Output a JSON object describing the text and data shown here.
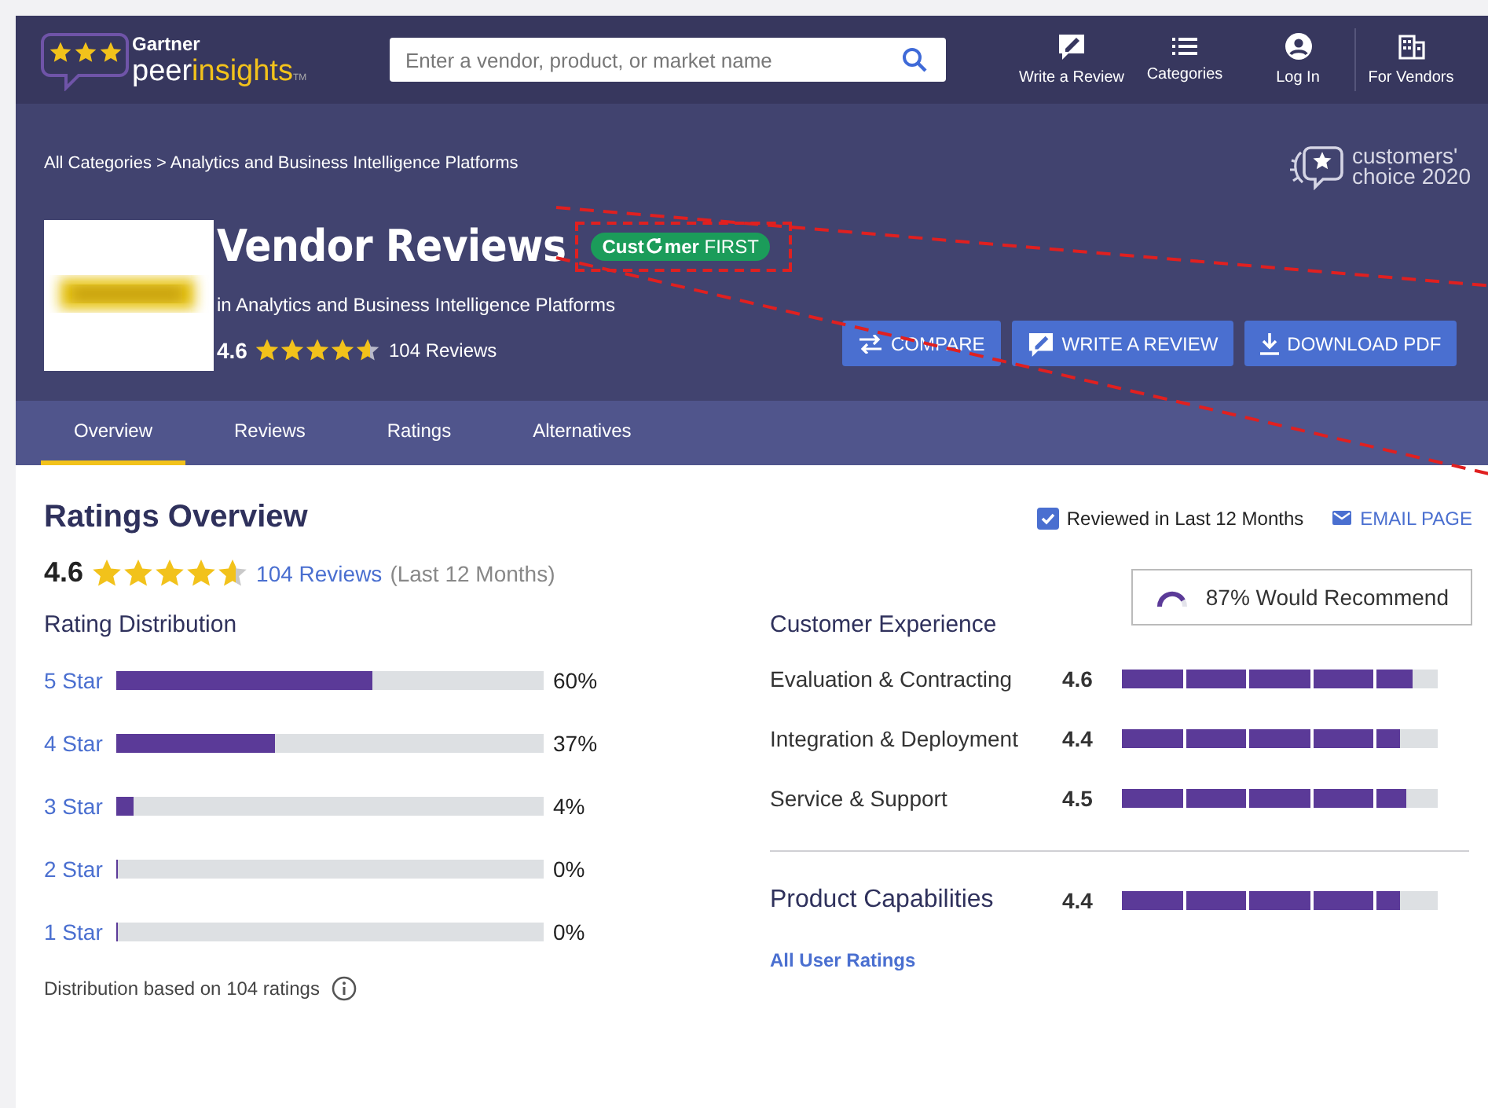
{
  "header": {
    "brand_top": "Gartner",
    "brand_main": "peer",
    "brand_accent": "insights",
    "brand_tm": "TM",
    "search": {
      "placeholder": "Enter a vendor, product, or market name"
    },
    "nav": [
      {
        "label": "Write a Review",
        "kind": "review"
      },
      {
        "label": "Categories",
        "kind": "list"
      },
      {
        "label": "Log In",
        "kind": "user"
      },
      {
        "label": "For Vendors",
        "kind": "building"
      }
    ]
  },
  "hero": {
    "breadcrumb": "All Categories > Analytics and Business Intelligence Platforms",
    "award": {
      "line1": "customers'",
      "line2": "choice 2020"
    },
    "title": "Vendor Reviews",
    "badge": {
      "strong": "Cust",
      "mid": "mer",
      "light": "FIRST"
    },
    "subtitle": "in Analytics and Business Intelligence Platforms",
    "rating": "4.6",
    "stars": 4.6,
    "reviews": "104 Reviews",
    "buttons": [
      {
        "label": "COMPARE",
        "kind": "compare"
      },
      {
        "label": "WRITE A REVIEW",
        "kind": "review"
      },
      {
        "label": "DOWNLOAD PDF",
        "kind": "download"
      }
    ]
  },
  "tabs": [
    {
      "label": "Overview",
      "selected": true
    },
    {
      "label": "Reviews",
      "selected": false
    },
    {
      "label": "Ratings",
      "selected": false
    },
    {
      "label": "Alternatives",
      "selected": false
    }
  ],
  "overview": {
    "title": "Ratings Overview",
    "filter": {
      "label": "Reviewed in Last 12 Months",
      "checked": true
    },
    "email": "EMAIL PAGE",
    "rating": "4.6",
    "stars": 4.6,
    "reviews_link": "104 Reviews",
    "period": "(Last 12 Months)",
    "recommend": "87% Would Recommend",
    "distribution": {
      "title": "Rating Distribution",
      "rows": [
        {
          "label": "5 Star",
          "level": 0.6,
          "percent": "60%"
        },
        {
          "label": "4 Star",
          "level": 0.37,
          "percent": "37%"
        },
        {
          "label": "3 Star",
          "level": 0.04,
          "percent": "4%"
        },
        {
          "label": "2 Star",
          "level": 0,
          "percent": "0%"
        },
        {
          "label": "1 Star",
          "level": 0,
          "percent": "0%"
        }
      ],
      "note": "Distribution based on 104 ratings"
    },
    "experience": {
      "title": "Customer Experience",
      "rows": [
        {
          "label": "Evaluation & Contracting",
          "score": "4.6",
          "level": 0.92
        },
        {
          "label": "Integration & Deployment",
          "score": "4.4",
          "level": 0.88
        },
        {
          "label": "Service & Support",
          "score": "4.5",
          "level": 0.9
        }
      ]
    },
    "capabilities": {
      "label": "Product Capabilities",
      "score": "4.4",
      "level": 0.88
    },
    "all_ratings": "All User Ratings"
  }
}
